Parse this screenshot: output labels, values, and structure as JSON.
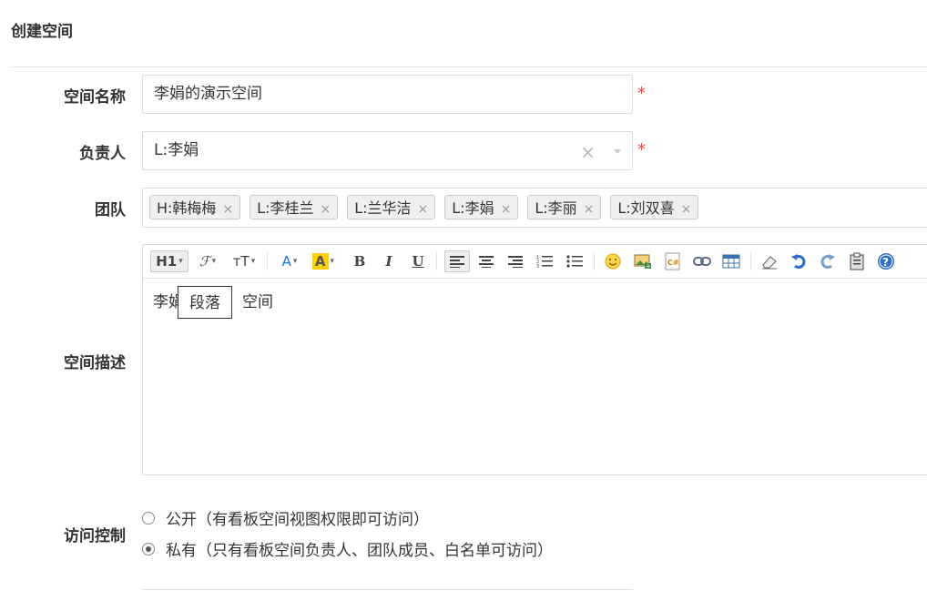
{
  "page_title": "创建空间",
  "fields": {
    "name_label": "空间名称",
    "name_value": "李娟的演示空间",
    "owner_label": "负责人",
    "owner_value": "L:李娟",
    "team_label": "团队",
    "team_members": [
      "H:韩梅梅",
      "L:李桂兰",
      "L:兰华洁",
      "L:李娟",
      "L:李丽",
      "L:刘双喜"
    ],
    "tag_remove": "×",
    "clear_glyph": "×",
    "desc_label": "空间描述",
    "required_mark": "*"
  },
  "editor": {
    "text_prefix": "李娟",
    "text_suffix": "空间",
    "tooltip": "段落",
    "heading_btn": "H1",
    "font_btn": "ℱ",
    "size_btn": "тT",
    "color_btn": "A",
    "bg_btn": "A",
    "bold": "B",
    "italic": "I",
    "underline": "U",
    "accent_color": "#1a73e8",
    "highlight_color": "#ffd100"
  },
  "access": {
    "label": "访问控制",
    "options": [
      {
        "label": "公开（有看板空间视图权限即可访问）",
        "selected": false
      },
      {
        "label": "私有（只有看板空间负责人、团队成员、白名单可访问）",
        "selected": true
      }
    ]
  }
}
